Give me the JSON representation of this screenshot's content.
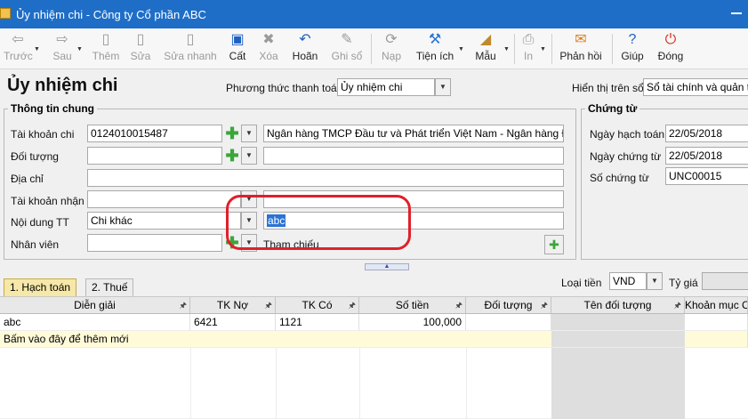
{
  "window": {
    "title": "Ủy nhiệm chi - Công ty Cổ phần ABC"
  },
  "toolbar": {
    "items": [
      {
        "label": "Trước",
        "icon": "arrow-left-icon",
        "enabled": false
      },
      {
        "label": "Sau",
        "icon": "arrow-right-icon",
        "enabled": false
      },
      {
        "label": "Thêm",
        "icon": "add-document-icon",
        "enabled": false
      },
      {
        "label": "Sửa",
        "icon": "edit-document-icon",
        "enabled": false
      },
      {
        "label": "Sửa nhanh",
        "icon": "quick-edit-icon",
        "enabled": false
      },
      {
        "label": "Cất",
        "icon": "save-icon",
        "enabled": true
      },
      {
        "label": "Xóa",
        "icon": "delete-icon",
        "enabled": false
      },
      {
        "label": "Hoãn",
        "icon": "undo-icon",
        "enabled": true
      },
      {
        "label": "Ghi sổ",
        "icon": "pencil-icon",
        "enabled": false
      },
      {
        "label": "Nạp",
        "icon": "reload-icon",
        "enabled": false
      },
      {
        "label": "Tiện ích",
        "icon": "tools-icon",
        "enabled": true
      },
      {
        "label": "Mẫu",
        "icon": "template-icon",
        "enabled": true
      },
      {
        "label": "In",
        "icon": "print-icon",
        "enabled": false
      },
      {
        "label": "Phản hồi",
        "icon": "mail-icon",
        "enabled": true
      },
      {
        "label": "Giúp",
        "icon": "help-icon",
        "enabled": true
      },
      {
        "label": "Đóng",
        "icon": "close-power-icon",
        "enabled": true
      }
    ]
  },
  "header": {
    "page_title": "Ủy nhiệm chi",
    "payment_method_label": "Phương thức thanh toán",
    "payment_method_value": "Ủy nhiệm chi",
    "display_on_book_label": "Hiển thị trên sổ",
    "display_on_book_value": "Sổ tài chính và quản trị"
  },
  "general": {
    "title": "Thông tin chung",
    "account_label": "Tài khoản chi",
    "account_value": "0124010015487",
    "bank_value": "Ngân hàng TMCP Đầu tư và Phát triển Việt Nam - Ngân hàng Đầ",
    "object_label": "Đối tượng",
    "object_value": "",
    "address_label": "Địa chỉ",
    "address_value": "",
    "receive_account_label": "Tài khoản nhận",
    "receive_account_value": "",
    "content_label": "Nội dung TT",
    "content_value": "Chi khác",
    "content_desc_value": "abc",
    "employee_label": "Nhân viên",
    "employee_value": "",
    "reference_label": "Tham chiếu"
  },
  "voucher": {
    "title": "Chứng từ",
    "posting_date_label": "Ngày hạch toán",
    "posting_date_value": "22/05/2018",
    "voucher_date_label": "Ngày chứng từ",
    "voucher_date_value": "22/05/2018",
    "voucher_no_label": "Số chứng từ",
    "voucher_no_value": "UNC00015"
  },
  "tabs": {
    "accounting": "1. Hạch toán",
    "tax": "2. Thuế"
  },
  "currency": {
    "label": "Loại tiền",
    "value": "VND",
    "rate_label": "Tỷ giá"
  },
  "grid": {
    "columns": [
      "Diễn giải",
      "TK Nợ",
      "TK Có",
      "Số tiền",
      "Đối tượng",
      "Tên đối tượng",
      "Khoản mục C"
    ],
    "rows": [
      {
        "desc": "abc",
        "debit": "6421",
        "credit": "1121",
        "amount": "100,000",
        "object": "",
        "object_name": "",
        "item": ""
      }
    ],
    "new_row_hint": "Bấm vào đây để thêm mới"
  }
}
